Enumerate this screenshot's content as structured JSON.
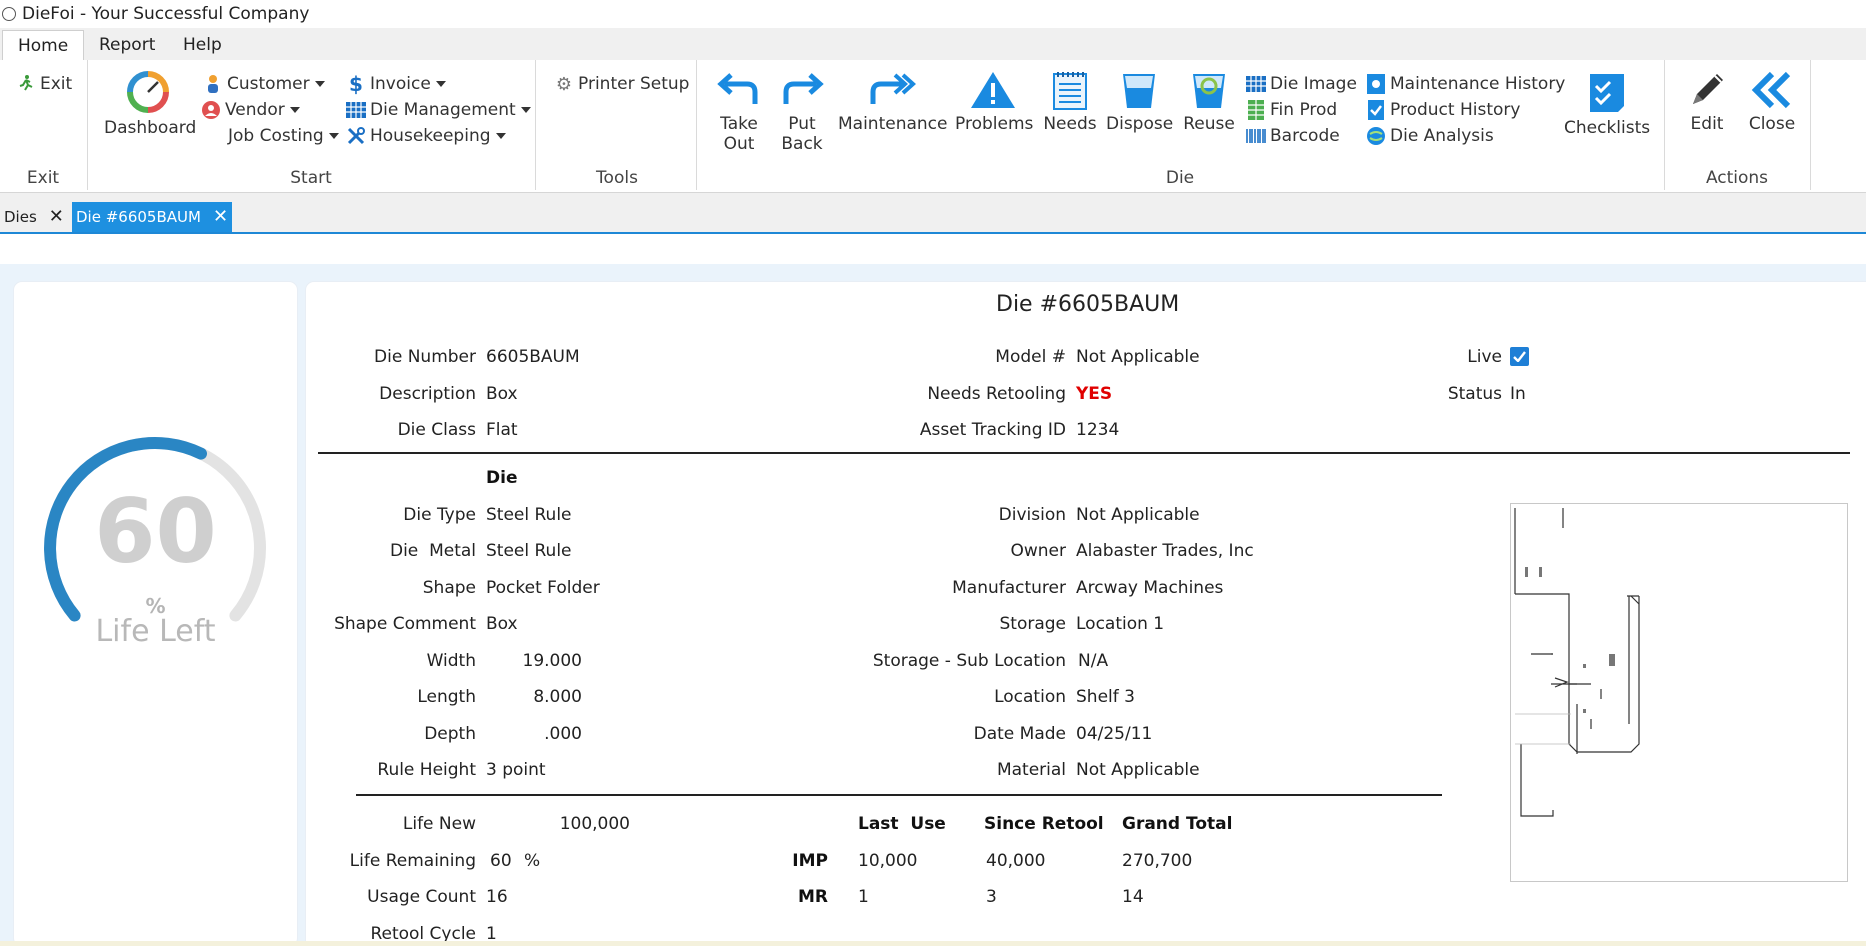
{
  "window": {
    "title": "DieFoi - Your Successful Company"
  },
  "menu_tabs": [
    "Home",
    "Report",
    "Help"
  ],
  "ribbon": {
    "groups": [
      "Exit",
      "Start",
      "Tools",
      "Die",
      "Actions"
    ],
    "exit": {
      "exit_label": "Exit"
    },
    "start": {
      "dashboard": "Dashboard",
      "customer": "Customer",
      "vendor": "Vendor",
      "job_costing": "Job Costing",
      "invoice": "Invoice",
      "die_management": "Die Management",
      "housekeeping": "Housekeeping"
    },
    "tools": {
      "printer_setup": "Printer Setup"
    },
    "die": {
      "take_out_1": "Take",
      "take_out_2": "Out",
      "put_back_1": "Put",
      "put_back_2": "Back",
      "maintenance": "Maintenance",
      "problems": "Problems",
      "needs": "Needs",
      "dispose": "Dispose",
      "reuse": "Reuse",
      "die_image": "Die Image",
      "fin_prod": "Fin Prod",
      "barcode": "Barcode",
      "maintenance_history": "Maintenance History",
      "product_history": "Product History",
      "die_analysis": "Die Analysis",
      "checklists": "Checklists"
    },
    "actions": {
      "edit": "Edit",
      "close": "Close"
    }
  },
  "doc_tabs": [
    {
      "label": "Dies",
      "close": "✕"
    },
    {
      "label": "Die #6605BAUM",
      "close": "✕"
    }
  ],
  "gauge": {
    "value": "60",
    "percent_sign": "%",
    "label": "Life Left",
    "fraction": 0.6
  },
  "die": {
    "title": "Die #6605BAUM",
    "header_fields": {
      "die_number": {
        "label": "Die Number",
        "value": "6605BAUM"
      },
      "description": {
        "label": "Description",
        "value": "Box"
      },
      "die_class": {
        "label": "Die Class",
        "value": "Flat"
      },
      "model": {
        "label": "Model #",
        "value": "Not Applicable"
      },
      "needs_retooling": {
        "label": "Needs Retooling",
        "value": "YES"
      },
      "asset_tracking": {
        "label": "Asset Tracking ID",
        "value": "1234"
      },
      "live": {
        "label": "Live",
        "checked": true
      },
      "status": {
        "label": "Status",
        "value": "In"
      }
    },
    "section_title": "Die",
    "left_fields": [
      {
        "label": "Die Type",
        "value": "Steel Rule"
      },
      {
        "label": "Die  Metal",
        "value": "Steel Rule"
      },
      {
        "label": "Shape",
        "value": "Pocket Folder"
      },
      {
        "label": "Shape Comment",
        "value": "Box"
      },
      {
        "label": "Width",
        "value": "19.000"
      },
      {
        "label": "Length",
        "value": "8.000"
      },
      {
        "label": "Depth",
        "value": ".000"
      },
      {
        "label": "Rule Height",
        "value": "3 point"
      }
    ],
    "right_fields": [
      {
        "label": "Division",
        "value": "Not Applicable"
      },
      {
        "label": "Owner",
        "value": "Alabaster Trades, Inc"
      },
      {
        "label": "Manufacturer",
        "value": "Arcway Machines"
      },
      {
        "label": "Storage",
        "value": "Location 1"
      },
      {
        "label": "Storage - Sub Location",
        "value": "N/A"
      },
      {
        "label": "Location",
        "value": "Shelf 3"
      },
      {
        "label": "Date Made",
        "value": "04/25/11"
      },
      {
        "label": "Material",
        "value": "Not Applicable"
      }
    ],
    "life": {
      "life_new": {
        "label": "Life New",
        "value": "100,000"
      },
      "life_remaining": {
        "label": "Life Remaining",
        "value": "60",
        "unit": "%"
      },
      "usage_count": {
        "label": "Usage Count",
        "value": "16"
      },
      "retool_cycle": {
        "label": "Retool Cycle",
        "value": "1"
      }
    },
    "usage_table": {
      "columns": [
        "Last  Use",
        "Since Retool",
        "Grand Total"
      ],
      "rows": [
        {
          "label": "IMP",
          "values": [
            "10,000",
            "40,000",
            "270,700"
          ]
        },
        {
          "label": "MR",
          "values": [
            "1",
            "3",
            "14"
          ]
        }
      ]
    }
  },
  "colors": {
    "accent": "#1e90e0",
    "gauge_arc": "#2a86c4",
    "gauge_track": "#e3e3e3",
    "alert": "#e00000"
  }
}
